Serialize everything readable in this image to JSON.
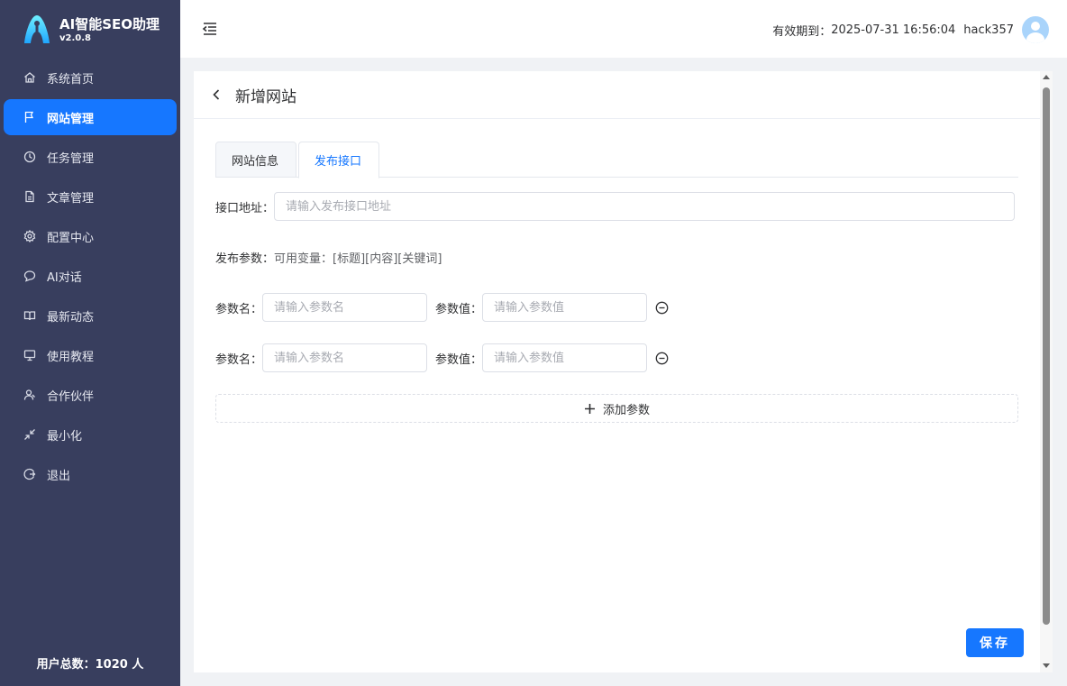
{
  "brand": {
    "app_name": "AI智能SEO助理",
    "version": "v2.0.8"
  },
  "sidebar": {
    "items": [
      {
        "label": "系统首页",
        "icon": "home-icon"
      },
      {
        "label": "网站管理",
        "icon": "flag-icon",
        "active": true
      },
      {
        "label": "任务管理",
        "icon": "clock-icon"
      },
      {
        "label": "文章管理",
        "icon": "document-icon"
      },
      {
        "label": "配置中心",
        "icon": "gear-icon"
      },
      {
        "label": "AI对话",
        "icon": "chat-icon"
      },
      {
        "label": "最新动态",
        "icon": "book-icon"
      },
      {
        "label": "使用教程",
        "icon": "monitor-icon"
      },
      {
        "label": "合作伙伴",
        "icon": "user-icon"
      },
      {
        "label": "最小化",
        "icon": "minimize-icon"
      },
      {
        "label": "退出",
        "icon": "logout-icon"
      }
    ],
    "user_total": "用户总数：1020 人"
  },
  "header": {
    "expiry_label": "有效期到：",
    "expiry_value": "2025-07-31 16:56:04",
    "username": "hack357"
  },
  "page": {
    "title": "新增网站",
    "tabs": [
      {
        "label": "网站信息",
        "active": false
      },
      {
        "label": "发布接口",
        "active": true
      }
    ],
    "api_url": {
      "label": "接口地址：",
      "placeholder": "请输入发布接口地址",
      "value": ""
    },
    "publish_params": {
      "label": "发布参数：",
      "hint": "可用变量：[标题][内容][关键词]"
    },
    "params": [
      {
        "name_label": "参数名：",
        "name_placeholder": "请输入参数名",
        "value_label": "参数值：",
        "value_placeholder": "请输入参数值"
      },
      {
        "name_label": "参数名：",
        "name_placeholder": "请输入参数名",
        "value_label": "参数值：",
        "value_placeholder": "请输入参数值"
      }
    ],
    "add_param_label": "添加参数",
    "save_label": "保存"
  },
  "colors": {
    "sidebar_bg": "#383e5e",
    "accent": "#1677ff"
  }
}
